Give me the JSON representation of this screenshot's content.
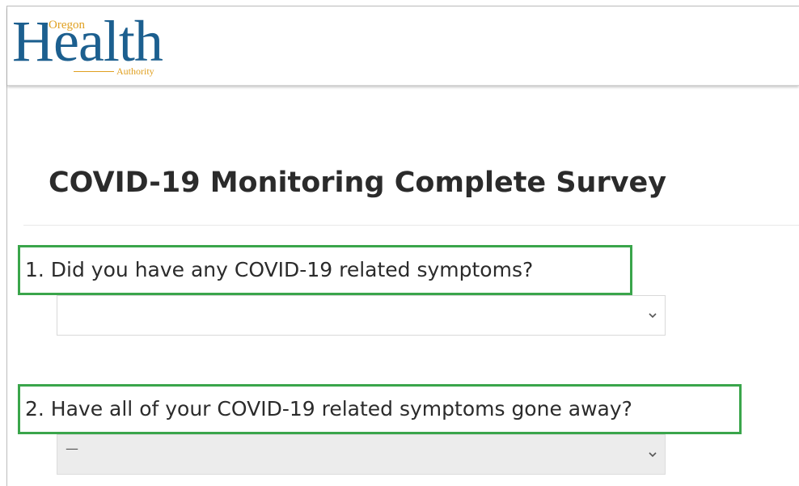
{
  "header": {
    "logo": {
      "main": "Health",
      "top_small": "Oregon",
      "bottom_small": "Authority",
      "colors": {
        "main": "#1c5f8f",
        "accent": "#e0a020"
      }
    }
  },
  "page": {
    "title": "COVID-19 Monitoring Complete Survey"
  },
  "questions": [
    {
      "label": "1. Did you have any COVID-19 related symptoms?",
      "select_value": "",
      "disabled": false,
      "dropdown_icon": "chevron-down-icon"
    },
    {
      "label": "2. Have all of your COVID-19 related symptoms gone away?",
      "select_value": "—",
      "disabled": true,
      "dropdown_icon": "chevron-down-icon"
    }
  ],
  "colors": {
    "highlight_border": "#3aa54b",
    "title_text": "#2b2b2b",
    "disabled_field": "#ececec"
  }
}
